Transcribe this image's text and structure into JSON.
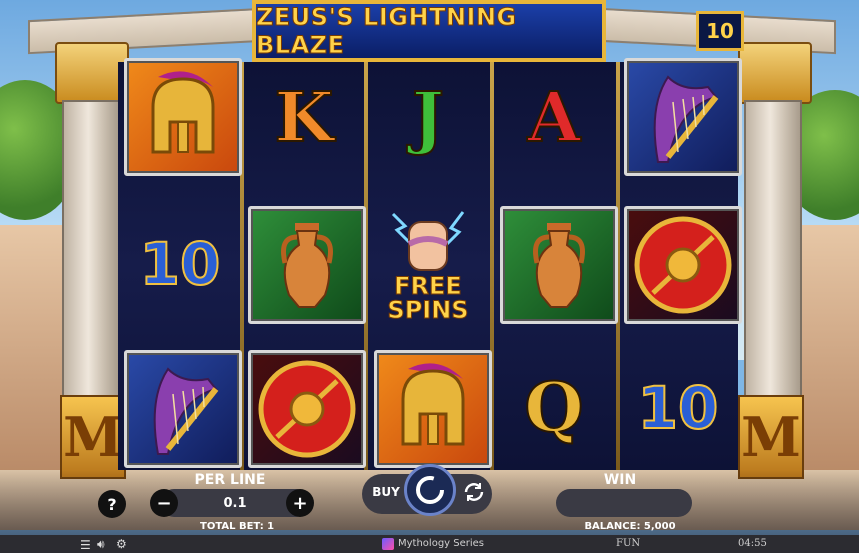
{
  "game": {
    "title": "ZEUS'S LIGHTNING BLAZE",
    "lines_badge": "10"
  },
  "reels": [
    [
      {
        "symbol": "spartan-helmet",
        "label": ""
      },
      {
        "symbol": "ten",
        "label": "10"
      },
      {
        "symbol": "harp",
        "label": ""
      }
    ],
    [
      {
        "symbol": "letter-k",
        "label": "K"
      },
      {
        "symbol": "amphora",
        "label": ""
      },
      {
        "symbol": "shield",
        "label": ""
      }
    ],
    [
      {
        "symbol": "letter-j",
        "label": "J"
      },
      {
        "symbol": "free-spins",
        "label": "FREE SPINS"
      },
      {
        "symbol": "spartan-helmet",
        "label": ""
      }
    ],
    [
      {
        "symbol": "letter-a",
        "label": "A"
      },
      {
        "symbol": "amphora",
        "label": ""
      },
      {
        "symbol": "letter-q",
        "label": "Q"
      }
    ],
    [
      {
        "symbol": "harp",
        "label": ""
      },
      {
        "symbol": "shield",
        "label": ""
      },
      {
        "symbol": "ten",
        "label": "10"
      }
    ]
  ],
  "controls": {
    "help_label": "?",
    "per_line_label": "PER LINE",
    "per_line_value": "0.1",
    "minus_label": "−",
    "plus_label": "+",
    "total_bet_label": "TOTAL BET: 1",
    "buy_label": "BUY",
    "win_label": "WIN",
    "win_value": "",
    "balance_label": "BALANCE: 5,000"
  },
  "statusbar": {
    "series_label": "Mythology Series",
    "mode_label": "FUN",
    "clock": "04:55"
  },
  "colors": {
    "gold": "#e8b63a",
    "reel_bg": "#0d1236",
    "title_bg": "#1b3fa8"
  }
}
